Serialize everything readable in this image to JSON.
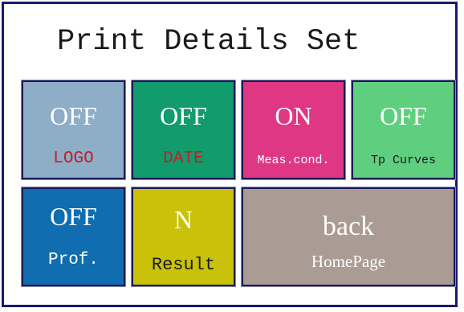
{
  "page": {
    "title": "Print Details Set"
  },
  "tiles": {
    "logo": {
      "state": "OFF",
      "label": "LOGO",
      "bg": "#8eadc7",
      "label_color": "#c0202a"
    },
    "date": {
      "state": "OFF",
      "label": "DATE",
      "bg": "#129b6c",
      "label_color": "#c0202a"
    },
    "meas_cond": {
      "state": "ON",
      "label": "Meas.cond.",
      "bg": "#df3783",
      "label_color": "#ffffff"
    },
    "tp_curves": {
      "state": "OFF",
      "label": "Tp Curves",
      "bg": "#5fcf7f",
      "label_color": "#1a1a1a"
    },
    "prof": {
      "state": "OFF",
      "label": "Prof.",
      "bg": "#0f6db0",
      "label_color": "#ffffff"
    },
    "result": {
      "state": "N",
      "label": "Result",
      "bg": "#c9c10a",
      "label_color": "#1a1a1a"
    },
    "back": {
      "state": "back",
      "label": "HomePage",
      "bg": "#aa9b95",
      "label_color": "#ffffff"
    }
  }
}
